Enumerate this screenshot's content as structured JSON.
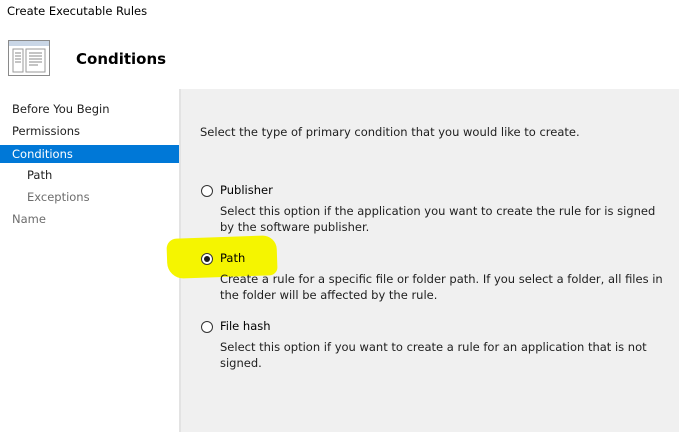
{
  "window": {
    "title": "Create Executable Rules"
  },
  "header": {
    "title": "Conditions",
    "icon": "wizard-page-icon"
  },
  "sidebar": {
    "items": [
      {
        "label": "Before You Begin",
        "state": "normal",
        "level": 0
      },
      {
        "label": "Permissions",
        "state": "normal",
        "level": 0
      },
      {
        "label": "Conditions",
        "state": "active",
        "level": 0
      },
      {
        "label": "Path",
        "state": "normal",
        "level": 1
      },
      {
        "label": "Exceptions",
        "state": "disabled",
        "level": 1
      },
      {
        "label": "Name",
        "state": "disabled",
        "level": 0
      }
    ]
  },
  "main": {
    "intro": "Select the type of primary condition that you would like to create.",
    "options": [
      {
        "label": "Publisher",
        "selected": false,
        "description": "Select this option if the application you want to create the rule for is signed by the software publisher."
      },
      {
        "label": "Path",
        "selected": true,
        "description": "Create a rule for a specific file or folder path. If you select a folder, all files in the folder will be affected by the rule."
      },
      {
        "label": "File hash",
        "selected": false,
        "description": "Select this option if you want to create a rule for an application that is not signed."
      }
    ]
  },
  "colors": {
    "accent": "#0078d7",
    "highlight": "#f5f500",
    "panel": "#f0f0f0"
  }
}
